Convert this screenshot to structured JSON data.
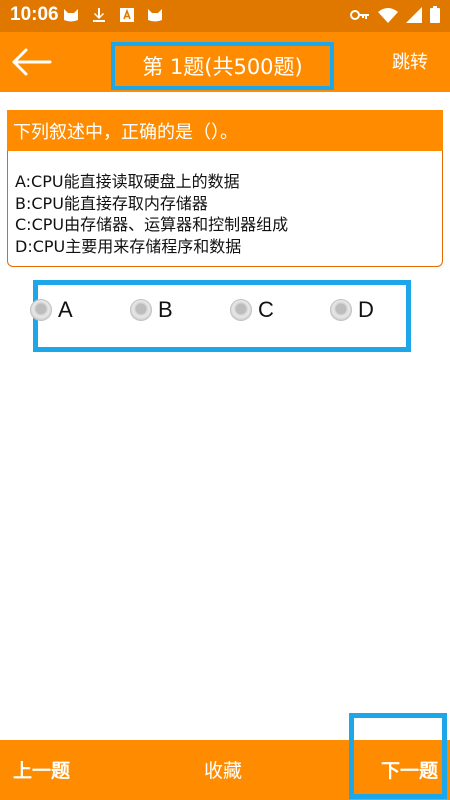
{
  "status_bar": {
    "time": "10:06",
    "left_icons": [
      "cat-icon",
      "download-icon",
      "font-a-icon",
      "cat-icon"
    ],
    "right_icons": [
      "key-icon",
      "wifi-icon",
      "signal-icon",
      "battery-icon"
    ]
  },
  "app_bar": {
    "back_icon": "arrow-left-icon",
    "title": "第 1题(共500题)",
    "jump_label": "跳转"
  },
  "question": {
    "text": "下列叙述中，正确的是（）。",
    "options": [
      "A:CPU能直接读取硬盘上的数据",
      "B:CPU能直接存取内存储器",
      "C:CPU由存储器、运算器和控制器组成",
      "D:CPU主要用来存储程序和数据"
    ]
  },
  "answers": {
    "choices": [
      "A",
      "B",
      "C",
      "D"
    ],
    "selected": null
  },
  "bottom_bar": {
    "prev_label": "上一题",
    "favorite_label": "收藏",
    "next_label": "下一题"
  },
  "colors": {
    "primary": "#ff8c00",
    "status_bar": "#e07800",
    "highlight": "#1ea7e8"
  }
}
